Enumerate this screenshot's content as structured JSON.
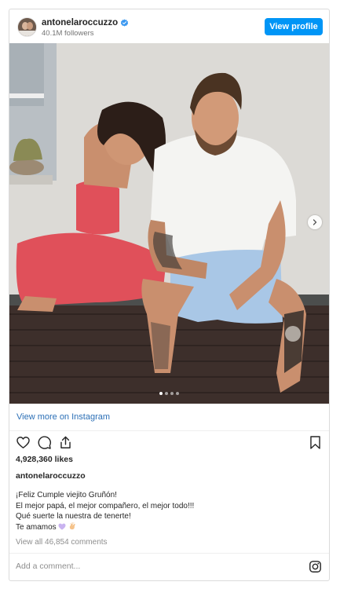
{
  "header": {
    "username": "antonelaroccuzzo",
    "followers": "40.1M followers",
    "view_profile_label": "View profile"
  },
  "post": {
    "photo_alt": "Antonela Roccuzzo and Lionel Messi sitting together",
    "carousel": {
      "count": 4,
      "active_index": 0
    },
    "view_more_label": "View more on Instagram",
    "likes": "4,928,360 likes",
    "caption_username": "antonelaroccuzzo",
    "caption_lines": [
      "¡Feliz Cumple viejito Gruñón!",
      "El mejor papá, el mejor compañero, el mejor todo!!!",
      "Qué suerte la nuestra de tenerte!",
      "Te amamos"
    ],
    "caption_emojis": [
      "purple-heart",
      "clapping-hands"
    ],
    "view_comments_label": "View all 46,854 comments",
    "comment_placeholder": "Add a comment..."
  },
  "colors": {
    "accent": "#0095f6",
    "link": "#2b6fb6",
    "verified": "#3897f0",
    "muted": "#8e8e8e"
  },
  "icons": [
    "verified-badge-icon",
    "chevron-right-icon",
    "heart-icon",
    "comment-icon",
    "share-icon",
    "bookmark-icon",
    "instagram-icon"
  ]
}
